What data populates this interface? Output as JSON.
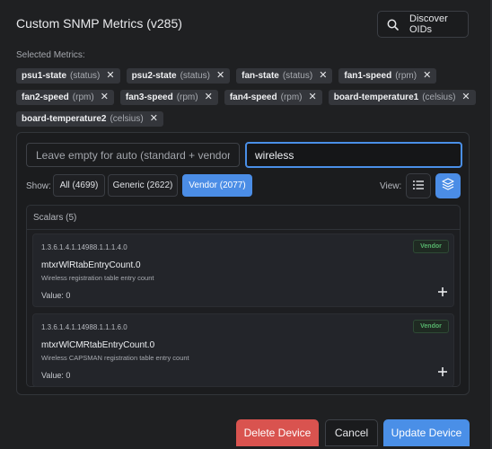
{
  "dialog": {
    "title": "Custom SNMP Metrics (v285)",
    "discover_label": "Discover OIDs",
    "selected_label": "Selected Metrics:"
  },
  "chips": [
    {
      "name": "psu1-state",
      "unit": "(status)"
    },
    {
      "name": "psu2-state",
      "unit": "(status)"
    },
    {
      "name": "fan-state",
      "unit": "(status)"
    },
    {
      "name": "fan1-speed",
      "unit": "(rpm)"
    },
    {
      "name": "fan2-speed",
      "unit": "(rpm)"
    },
    {
      "name": "fan3-speed",
      "unit": "(rpm)"
    },
    {
      "name": "fan4-speed",
      "unit": "(rpm)"
    },
    {
      "name": "board-temperature1",
      "unit": "(celsius)"
    },
    {
      "name": "board-temperature2",
      "unit": "(celsius)"
    }
  ],
  "chip_remove": "✕",
  "search": {
    "left_placeholder": "Leave empty for auto (standard + vendor)",
    "right_value": "wireless"
  },
  "filter": {
    "show_label": "Show:",
    "all": "All (4699)",
    "generic": "Generic (2622)",
    "vendor": "Vendor (2077)",
    "active": "vendor",
    "view_label": "View:",
    "active_view": "card"
  },
  "scalars": {
    "title": "Scalars (5)",
    "items": [
      {
        "oid": "1.3.6.1.4.1.14988.1.1.1.4.0",
        "badge": "Vendor",
        "name": "mtxrWlRtabEntryCount.0",
        "desc": "Wireless registration table entry count",
        "value": "Value: 0"
      },
      {
        "oid": "1.3.6.1.4.1.14988.1.1.1.6.0",
        "badge": "Vendor",
        "name": "mtxrWlCMRtabEntryCount.0",
        "desc": "Wireless CAPSMAN registration table entry count",
        "value": "Value: 0"
      }
    ]
  },
  "footer": {
    "delete": "Delete Device",
    "cancel": "Cancel",
    "update": "Update Device"
  },
  "colors": {
    "accent": "#4b8de6",
    "danger": "#d9534f",
    "vendor_badge": "#56b36b",
    "background": "#1f2022"
  }
}
